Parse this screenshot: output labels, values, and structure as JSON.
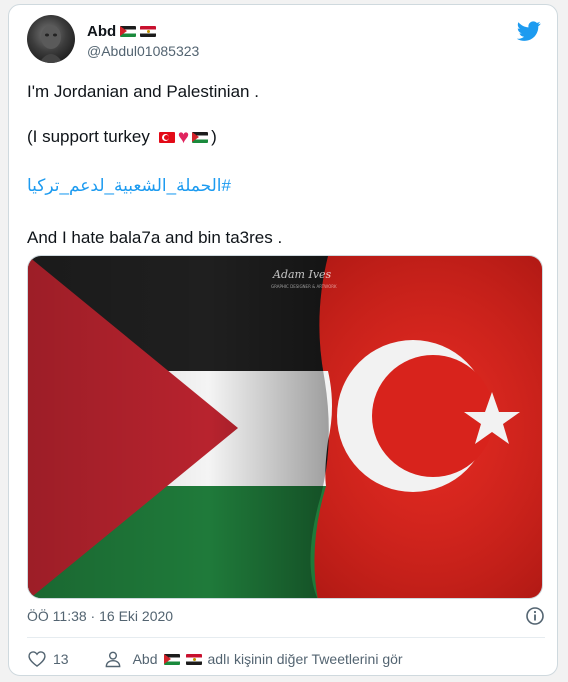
{
  "author": {
    "name": "Abd",
    "handle": "@Abdul01085323",
    "name_flags": [
      "palestine-flag-icon",
      "egypt-flag-icon"
    ]
  },
  "tweet": {
    "line1": "I'm Jordanian and Palestinian .",
    "line2_prefix": "(I support turkey",
    "line2_suffix": ")",
    "line2_icons": [
      "turkey-flag-icon",
      "heart-icon",
      "palestine-flag-icon"
    ],
    "hashtag": "#الحملة_الشعبية_لدعم_تركيا",
    "line4": "And  I hate bala7a and bin ta3res ."
  },
  "media": {
    "watermark_line1": "Adam Ives",
    "watermark_line2": "GRAPHIC DESIGNER & ARTWORK"
  },
  "meta": {
    "timestamp": "ÖÖ 11:38 · 16 Eki 2020"
  },
  "actions": {
    "like_count": "13",
    "more_prefix": "Abd",
    "more_suffix": "adlı kişinin diğer Tweetlerini gör"
  },
  "colors": {
    "link": "#1d9bf0",
    "twitter_blue": "#1d9bf0",
    "heart": "#e0245e",
    "muted": "#536471"
  }
}
